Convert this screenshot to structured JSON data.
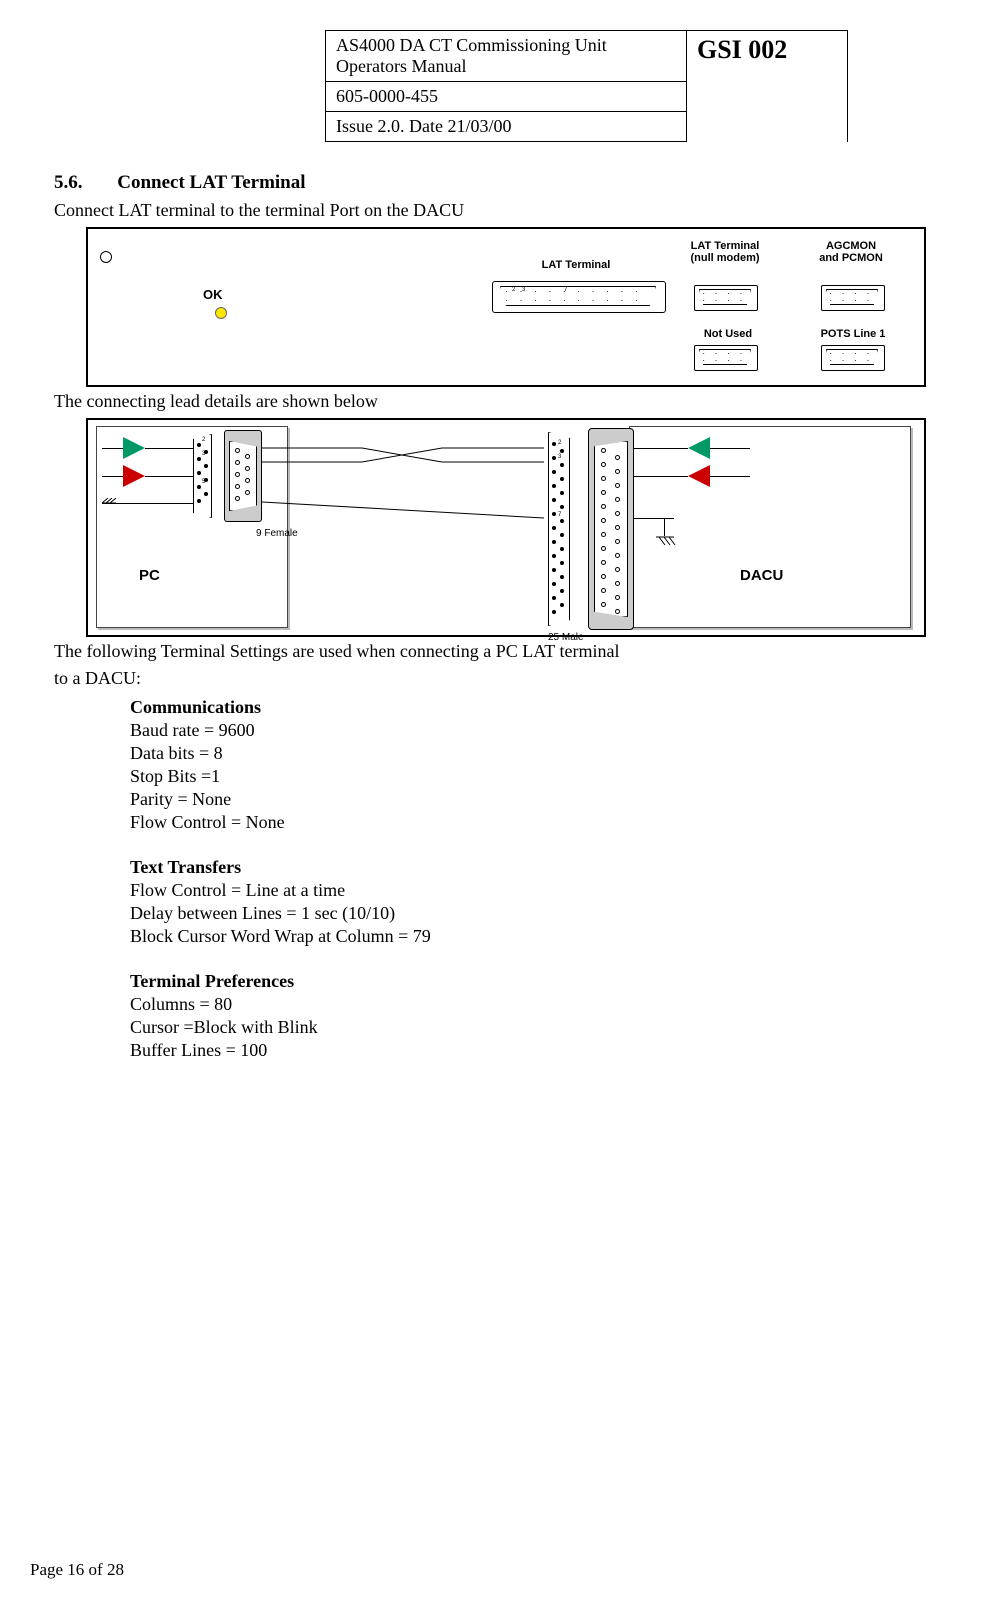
{
  "header": {
    "title_line1": "AS4000 DA CT Commissioning Unit",
    "title_line2": "Operators Manual",
    "docnum": "605-0000-455",
    "issue": "Issue 2.0.  Date 21/03/00",
    "gsi": "GSI 002"
  },
  "section": {
    "number": "5.6.",
    "title": "Connect LAT Terminal"
  },
  "intro_line": "Connect LAT terminal to the terminal Port on the DACU",
  "diagram1": {
    "ok": "OK",
    "lat_terminal": "LAT Terminal",
    "lat_null": "LAT Terminal\n(null modem)",
    "agcmon": "AGCMON\nand PCMON",
    "not_used": "Not Used",
    "pots": "POTS Line 1",
    "pin2": "2",
    "pin3": "3",
    "pin7": "7"
  },
  "mid_line": "The connecting lead details are shown below",
  "diagram2": {
    "pc": "PC",
    "dacu": "DACU",
    "female": "9 Female",
    "male": "25 Male",
    "p2": "2",
    "p3": "3",
    "p5": "5",
    "p7": "7"
  },
  "post_line1": "The following Terminal Settings are used when connecting a PC LAT terminal",
  "post_line2": "to a DACU:",
  "settings": {
    "comm_title": "Communications",
    "comm": [
      "Baud rate = 9600",
      "Data bits = 8",
      "Stop Bits =1",
      "Parity = None",
      "Flow Control = None"
    ],
    "text_title": "Text Transfers",
    "text": [
      "Flow Control = Line at a time",
      "Delay between Lines = 1 sec (10/10)",
      "Block Cursor Word Wrap at Column = 79"
    ],
    "pref_title": "Terminal Preferences",
    "pref": [
      "Columns = 80",
      "Cursor =Block with Blink",
      "Buffer Lines = 100"
    ]
  },
  "footer": "Page 16 of 28"
}
